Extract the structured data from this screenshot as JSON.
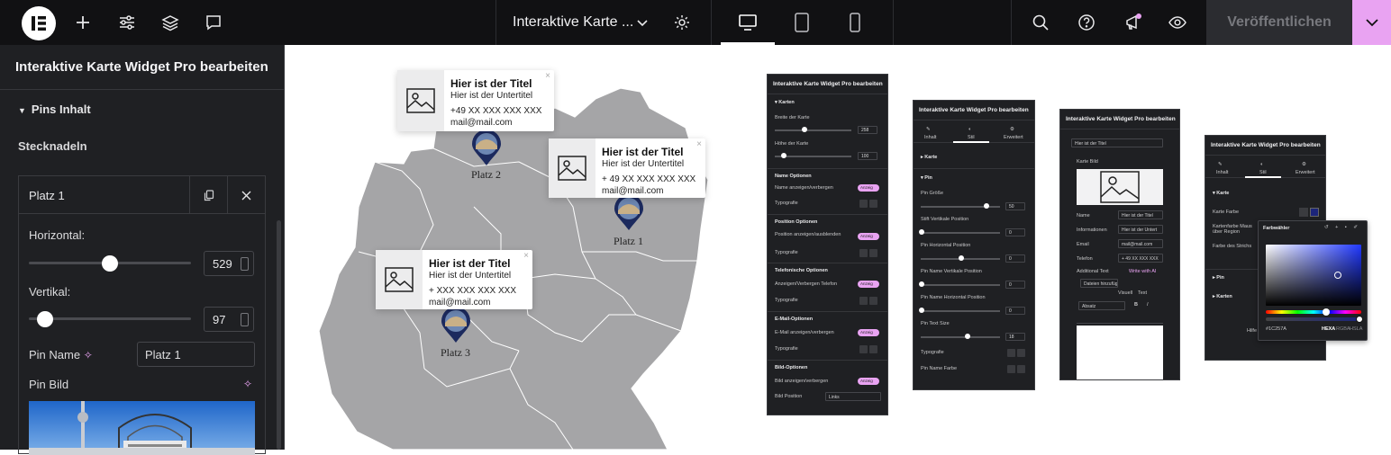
{
  "topbar": {
    "document_title": "Interaktive Karte ...",
    "publish_label": "Veröffentlichen",
    "brand_color": "#e9a3f2"
  },
  "panel": {
    "title": "Interaktive Karte Widget Pro bearbeiten",
    "section_title": "Pins Inhalt",
    "subsection_title": "Stecknadeln",
    "repeater_item": "Platz 1",
    "horizontal_label": "Horizontal:",
    "horizontal_value": "529",
    "horizontal_fraction": 0.5,
    "vertical_label": "Vertikal:",
    "vertical_value": "97",
    "vertical_fraction": 0.1,
    "pin_name_label": "Pin Name",
    "pin_name_value": "Platz 1",
    "pin_image_label": "Pin Bild"
  },
  "map": {
    "popups": [
      {
        "title": "Hier ist der Titel",
        "subtitle": "Hier ist der Untertitel",
        "phone": "+49 XX XXX XXX XXX",
        "mail": "mail@mail.com"
      },
      {
        "title": "Hier ist der Titel",
        "subtitle": "Hier ist der Untertitel",
        "phone": "+ 49 XX XXX XXX XXX",
        "mail": "mail@mail.com"
      },
      {
        "title": "Hier ist der Titel",
        "subtitle": "Hier ist der Untertitel",
        "phone": "+ XXX XXX XXX XXX",
        "mail": "mail@mail.com"
      }
    ],
    "pins": [
      "Platz 2",
      "Platz 1",
      "Platz 3"
    ],
    "close_glyph": "×"
  },
  "shot1": {
    "title": "Interaktive Karte Widget Pro bearbeiten",
    "section": "Karten",
    "map_width": "Breite der Karte",
    "map_width_val": "258",
    "map_height": "Höhe der Karte",
    "map_height_val": "100",
    "name_opts": "Name Optionen",
    "name_toggle": "Name anzeigen/verbergen",
    "typo": "Typografie",
    "pos_opts": "Position Optionen",
    "pos_toggle": "Position anzeigen/ausblenden",
    "tel_opts": "Telefonische Optionen",
    "tel_toggle": "Anzeigen/Verbergen Telefon",
    "mail_opts": "E-Mail-Optionen",
    "mail_toggle": "E-Mail anzeigen/verbergen",
    "img_opts": "Bild-Optionen",
    "img_toggle": "Bild anzeigen/verbergen",
    "img_pos": "Bild Position",
    "img_pos_val": "Links",
    "toggle_label": "Anzeig"
  },
  "shot2": {
    "title": "Interaktive Karte Widget Pro bearbeiten",
    "tabs": [
      "Inhalt",
      "Stil",
      "Erweitert"
    ],
    "karte": "Karte",
    "pin": "Pin",
    "pin_size": "Pin Größe",
    "pin_size_val": "50",
    "pin_vert": "Stift Vertikale Position",
    "pin_vert_val": "0",
    "pin_horz": "Pin Horizontal Position",
    "pin_horz_val": "0",
    "name_vert": "Pin Name Vertikale Position",
    "name_vert_val": "0",
    "name_horz": "Pin Name Horizontal Position",
    "name_horz_val": "0",
    "text_size": "Pin Text Size",
    "text_size_val": "18",
    "typo": "Typografie",
    "name_color": "Pin Name Farbe"
  },
  "shot3": {
    "title": "Interaktive Karte Widget Pro bearbeiten",
    "title_field": "Hier ist der Titel",
    "karte_bild": "Karte Bild",
    "name_label": "Name",
    "name_val": "Hier ist der Titel",
    "info_label": "Informationen",
    "info_val": "Hier ist der Untert",
    "email_label": "Email",
    "email_val": "mail@mail.com",
    "phone_label": "Telefon",
    "phone_val": "+ 49 XX XXX XXX",
    "extra_label": "Additional Text",
    "ai_label": "Write with AI",
    "media_btn": "Dateien hinzufügen",
    "visual_tab": "Visuell",
    "text_tab": "Text",
    "paragraph": "Absatz"
  },
  "shot4": {
    "title": "Interaktive Karte Widget Pro bearbeiten",
    "tabs": [
      "Inhalt",
      "Stil",
      "Erweitert"
    ],
    "karte": "Karte",
    "map_color": "Karte Farbe",
    "hover_color": "Kartenfarbe Maus über Region",
    "stroke_color": "Farbe des Strichs",
    "pin": "Pin",
    "karten": "Karten",
    "help": "Hilfe",
    "picker_title": "Farbwähler",
    "hex_val": "#1C257A",
    "formats": [
      "HEXA",
      "RGBA",
      "HSLA"
    ]
  }
}
